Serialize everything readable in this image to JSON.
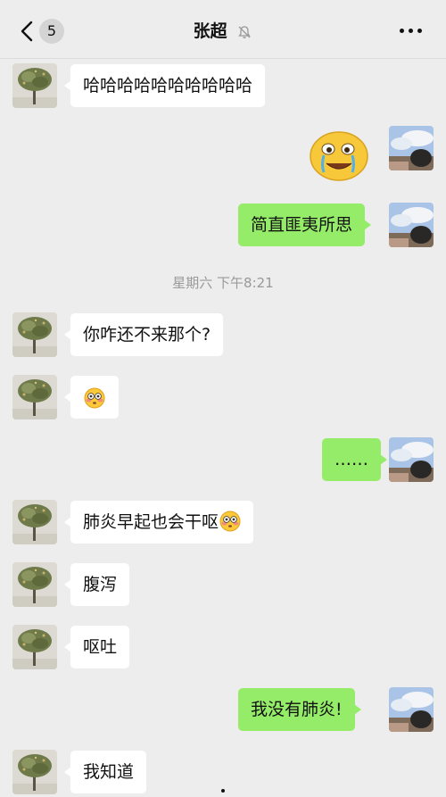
{
  "header": {
    "back_icon": "chevron-left-icon",
    "unread_count": "5",
    "title": "张超",
    "mute_icon": "bell-off-icon",
    "more_icon": "ellipsis-icon"
  },
  "timestamp": "星期六 下午8:21",
  "messages": [
    {
      "from": "contact",
      "text": "哈哈哈哈哈哈哈哈哈哈"
    },
    {
      "from": "me",
      "type": "sticker",
      "icon": "crying-laughing-sticker"
    },
    {
      "from": "me",
      "text": "简直匪夷所思"
    },
    {
      "from": "contact",
      "text": "你咋还不来那个?"
    },
    {
      "from": "contact",
      "type": "emoji",
      "icon": "flushed-face-emoji"
    },
    {
      "from": "me",
      "text": "……"
    },
    {
      "from": "contact",
      "text": "肺炎早起也会干呕",
      "trailing_icon": "flushed-face-emoji"
    },
    {
      "from": "contact",
      "text": "腹泻"
    },
    {
      "from": "contact",
      "text": "呕吐"
    },
    {
      "from": "me",
      "text": "我没有肺炎!"
    },
    {
      "from": "contact",
      "text": "我知道"
    }
  ],
  "colors": {
    "background": "#ededed",
    "outgoing_bubble": "#95ec69",
    "incoming_bubble": "#ffffff"
  }
}
